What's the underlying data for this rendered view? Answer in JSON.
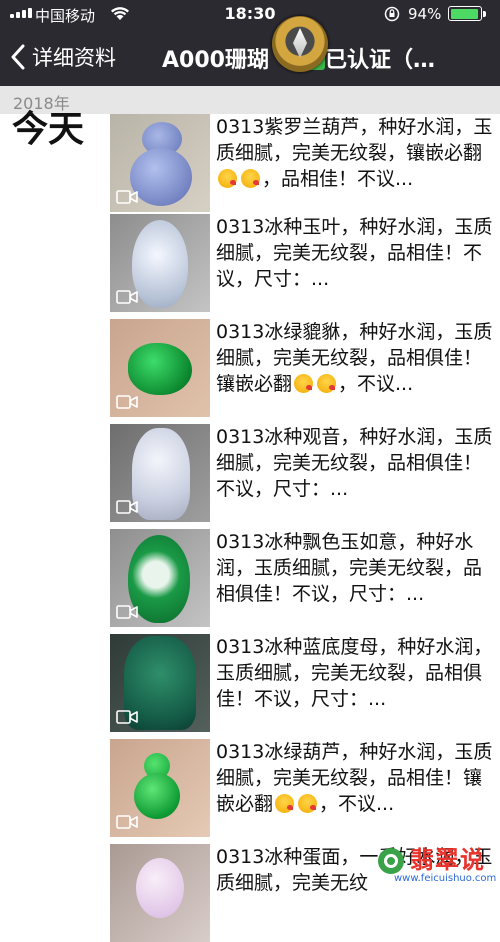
{
  "status_bar": {
    "carrier": "中国移动",
    "time": "18:30",
    "battery_percent": "94%",
    "battery_level": 0.94
  },
  "nav": {
    "back_label": "详细资料",
    "title": "A000珊瑚",
    "title_suffix": "已认证（…"
  },
  "year_label": "2018年",
  "today_label": "今天",
  "posts": [
    {
      "text_before": "0313紫罗兰葫芦，种好水润，玉质细腻，完美无纹裂，镶嵌必翻",
      "text_after": "，品相佳！不议...",
      "emoji_count": 2,
      "gem": "lavender-gourd"
    },
    {
      "text_before": "0313冰种玉叶，种好水润，玉质细腻，完美无纹裂，品相佳！不议，尺寸：...",
      "text_after": "",
      "emoji_count": 0,
      "gem": "ice-leaf"
    },
    {
      "text_before": "0313冰绿貔貅，种好水润，玉质细腻，完美无纹裂，品相俱佳！镶嵌必翻",
      "text_after": "，不议...",
      "emoji_count": 2,
      "gem": "green-pixiu"
    },
    {
      "text_before": "0313冰种观音，种好水润，玉质细腻，完美无纹裂，品相俱佳！不议，尺寸：...",
      "text_after": "",
      "emoji_count": 0,
      "gem": "ice-guanyin"
    },
    {
      "text_before": "0313冰种飘色玉如意，种好水润，玉质细腻，完美无纹裂，品相俱佳！不议，尺寸：...",
      "text_after": "",
      "emoji_count": 0,
      "gem": "green-ruyi"
    },
    {
      "text_before": "0313冰种蓝底度母，种好水润，玉质细腻，完美无纹裂，品相俱佳！不议，尺寸：...",
      "text_after": "",
      "emoji_count": 0,
      "gem": "blue-tara"
    },
    {
      "text_before": "0313冰绿葫芦，种好水润，玉质细腻，完美无纹裂，品相佳！镶嵌必翻",
      "text_after": "，不议...",
      "emoji_count": 2,
      "gem": "green-gourd"
    },
    {
      "text_before": "0313冰种蛋面，一手",
      "text_after": "好水润，玉质细腻，完美无纹",
      "emoji_count": 0,
      "gem": "egg"
    }
  ],
  "watermark": {
    "text": "翡翠说",
    "url": "www.feicuishuo.com"
  },
  "colors": {
    "bar_bg": "#2b2a30",
    "battery_green": "#4cd964",
    "verified_green": "#3cb54a",
    "year_bar_bg": "#e6e6e6",
    "watermark_red": "#e8342c"
  },
  "icons": {
    "signal": "signal-bars-icon",
    "wifi": "wifi-icon",
    "lock": "rotation-lock-icon",
    "back": "chevron-left-icon",
    "video": "video-camera-icon",
    "verified": "check-mark-icon"
  }
}
